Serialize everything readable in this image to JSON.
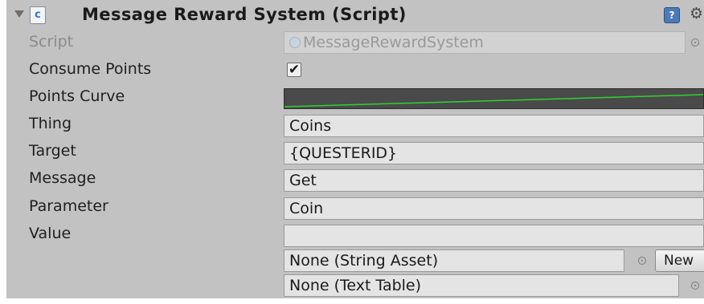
{
  "header": {
    "title": "Message Reward System (Script)",
    "script_icon_glyph": "c",
    "help_icon_glyph": "?",
    "gear_icon_glyph": "⚙"
  },
  "fields": {
    "script": {
      "label": "Script",
      "value": "MessageRewardSystem"
    },
    "consume_points": {
      "label": "Consume Points",
      "checked": true,
      "check_glyph": "✔"
    },
    "points_curve": {
      "label": "Points Curve",
      "curve_color": "#2fd22f"
    },
    "thing": {
      "label": "Thing",
      "value": "Coins"
    },
    "target": {
      "label": "Target",
      "value": "{QUESTERID}"
    },
    "message": {
      "label": "Message",
      "value": "Get"
    },
    "parameter": {
      "label": "Parameter",
      "value": "Coin"
    },
    "value": {
      "label": "Value",
      "text": "",
      "string_asset": "None (String Asset)",
      "new_button": "New",
      "text_table": "None (Text Table)"
    }
  },
  "colors": {
    "panel_background": "#c2c2c2",
    "field_background": "#e4e4e4",
    "curve_background": "#4a4a4a"
  }
}
